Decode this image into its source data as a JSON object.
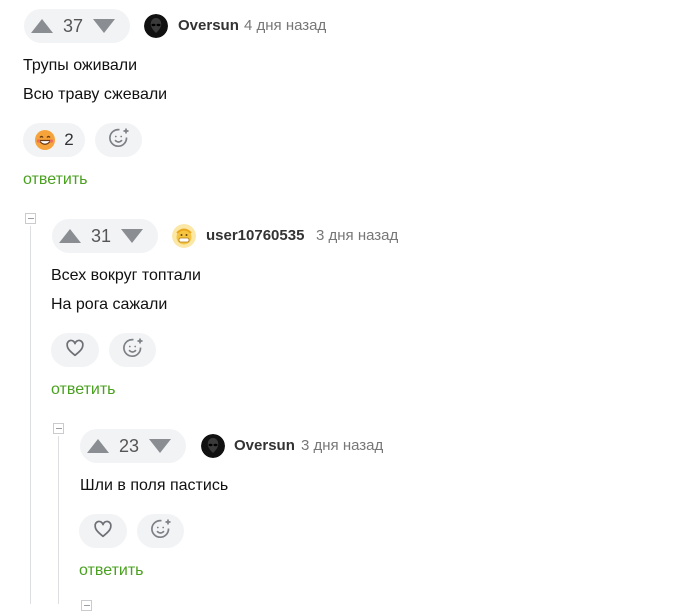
{
  "comments": [
    {
      "rating": "37",
      "author": "Oversun",
      "time": "4 дня назад",
      "lines": [
        "Трупы оживали",
        "Всю траву сжевали"
      ],
      "reaction_count": "2",
      "reply_label": "ответить"
    },
    {
      "rating": "31",
      "author": "user10760535",
      "time": "3 дня назад",
      "lines": [
        "Всех вокруг топтали",
        "На рога сажали"
      ],
      "reply_label": "ответить"
    },
    {
      "rating": "23",
      "author": "Oversun",
      "time": "3 дня назад",
      "lines": [
        "Шли в поля пастись"
      ],
      "reply_label": "ответить"
    }
  ],
  "colors": {
    "reply_link": "#4aa020",
    "pill_bg": "#f2f3f5",
    "arrow": "#8a8d91",
    "thread_line": "#dcdee1"
  },
  "icons": {
    "upvote": "upvote-arrow-icon",
    "downvote": "downvote-arrow-icon",
    "laugh_reaction": "grinning-face-icon",
    "add_reaction": "add-emoji-icon",
    "like": "heart-icon",
    "collapse": "collapse-minus-icon"
  }
}
